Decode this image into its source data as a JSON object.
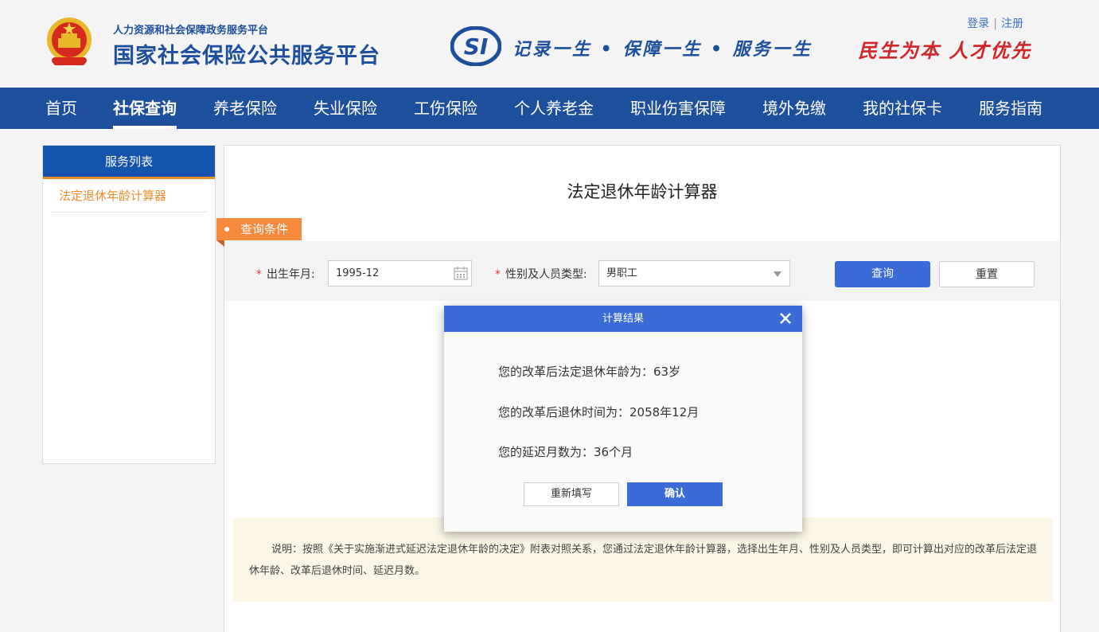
{
  "header": {
    "sub_title": "人力资源和社会保障政务服务平台",
    "title": "国家社会保险公共服务平台",
    "si_logo_text": "SI",
    "slogan": "记录一生 • 保障一生 • 服务一生",
    "motto": "民生为本 人才优先",
    "login": "登录",
    "separator": "|",
    "register": "注册"
  },
  "nav": {
    "items": [
      "首页",
      "社保查询",
      "养老保险",
      "失业保险",
      "工伤保险",
      "个人养老金",
      "职业伤害保障",
      "境外免缴",
      "我的社保卡",
      "服务指南"
    ],
    "active": "社保查询"
  },
  "sidebar": {
    "title": "服务列表",
    "items": [
      "法定退休年龄计算器"
    ]
  },
  "main": {
    "title": "法定退休年龄计算器",
    "condition_tag": "查询条件",
    "form": {
      "required_mark": "*",
      "birth_label": "出生年月:",
      "birth_value": "1995-12",
      "type_label": "性别及人员类型:",
      "type_value": "男职工",
      "query_button": "查询",
      "reset_button": "重置"
    },
    "note": "说明：按照《关于实施渐进式延迟法定退休年龄的决定》附表对照关系，您通过法定退休年龄计算器，选择出生年月、性别及人员类型，即可计算出对应的改革后法定退休年龄、改革后退休时间、延迟月数。"
  },
  "modal": {
    "title": "计算结果",
    "results": [
      "您的改革后法定退休年龄为：63岁",
      "您的改革后退休时间为：2058年12月",
      "您的延迟月数为：36个月"
    ],
    "refill_button": "重新填写",
    "confirm_button": "确认"
  },
  "colors": {
    "brand_blue": "#1d4f9c",
    "button_blue": "#3a6bd6",
    "accent_orange": "#f6893b",
    "motto_red": "#d0272d"
  },
  "icons": [
    "national-emblem-icon",
    "si-logo-icon",
    "calendar-icon",
    "chevron-down-icon",
    "close-icon"
  ]
}
